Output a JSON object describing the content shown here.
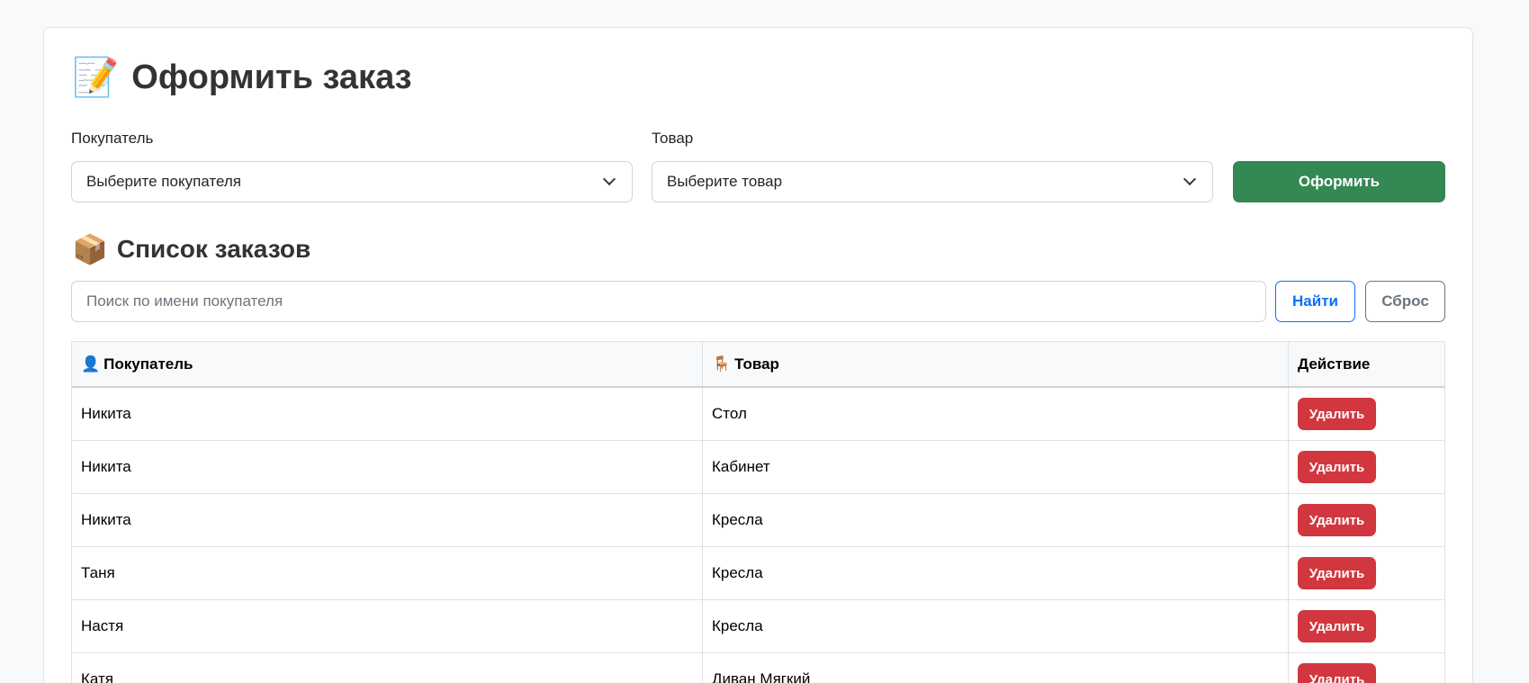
{
  "order_form": {
    "title_icon": "📝",
    "title": "Оформить заказ",
    "customer_label": "Покупатель",
    "customer_select": "Выберите покупателя",
    "product_label": "Товар",
    "product_select": "Выберите товар",
    "submit_label": "Оформить"
  },
  "orders": {
    "title_icon": "📦",
    "title": "Список заказов",
    "search_placeholder": "Поиск по имени покупателя",
    "find_label": "Найти",
    "reset_label": "Сброс",
    "columns": [
      {
        "icon": "👤",
        "label": "Покупатель"
      },
      {
        "icon": "🪑",
        "label": "Товар"
      },
      {
        "icon": "",
        "label": "Действие"
      }
    ],
    "delete_label": "Удалить",
    "rows": [
      {
        "customer": "Никита",
        "product": "Стол"
      },
      {
        "customer": "Никита",
        "product": "Кабинет"
      },
      {
        "customer": "Никита",
        "product": "Кресла"
      },
      {
        "customer": "Таня",
        "product": "Кресла"
      },
      {
        "customer": "Настя",
        "product": "Кресла"
      },
      {
        "customer": "Катя",
        "product": "Диван Мягкий"
      }
    ]
  },
  "colors": {
    "primary": "#0d6efd",
    "success": "#348853",
    "danger": "#d2373f"
  }
}
